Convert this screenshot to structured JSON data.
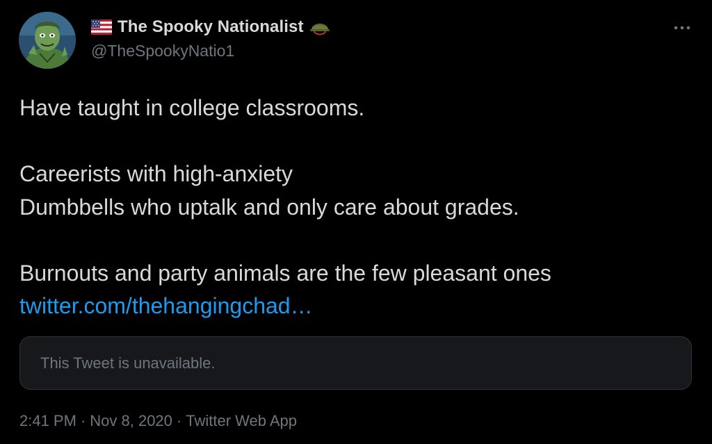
{
  "author": {
    "display_name": "The Spooky Nationalist",
    "handle": "@TheSpookyNatio1",
    "name_prefix_icon": "us-flag-icon",
    "name_suffix_icon": "army-helmet-icon",
    "avatar": "cartoon-ghoul-avatar"
  },
  "menu": {
    "icon": "more-options-icon"
  },
  "tweet": {
    "lines": [
      "Have taught in college classrooms.",
      "",
      "Careerists with high-anxiety",
      "Dumbbells who uptalk and only care about grades.",
      "",
      "Burnouts and party animals are the few pleasant ones"
    ],
    "link_text": "twitter.com/thehangingchad…"
  },
  "quoted": {
    "unavailable_text": "This Tweet is unavailable."
  },
  "meta": {
    "time": "2:41 PM",
    "separator": "·",
    "date": "Nov 8, 2020",
    "source": "Twitter Web App"
  },
  "colors": {
    "background": "#000000",
    "primary_text": "#d9d9d9",
    "secondary_text": "#6e767d",
    "link": "#1d9bf0",
    "card_background": "#16181c",
    "card_border": "#2f3336"
  }
}
